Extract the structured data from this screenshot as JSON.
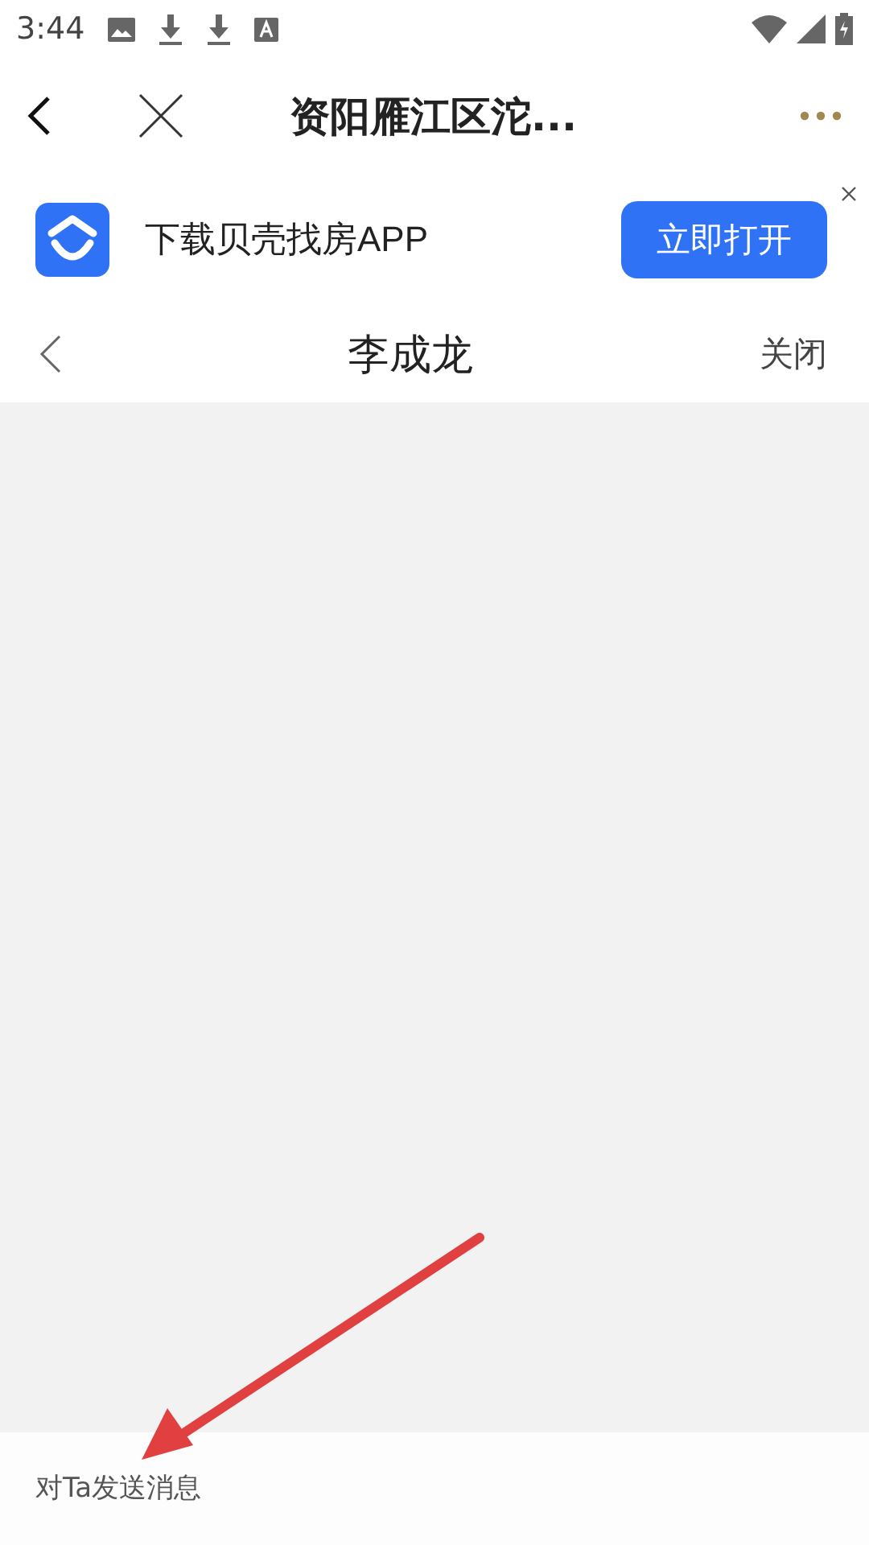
{
  "status_bar": {
    "time": "3:44"
  },
  "nav": {
    "title": "资阳雁江区沱..."
  },
  "banner": {
    "text": "下载贝壳找房APP",
    "button": "立即打开"
  },
  "chat_header": {
    "title": "李成龙",
    "close": "关闭"
  },
  "message_input": {
    "placeholder": "对Ta发送消息"
  }
}
